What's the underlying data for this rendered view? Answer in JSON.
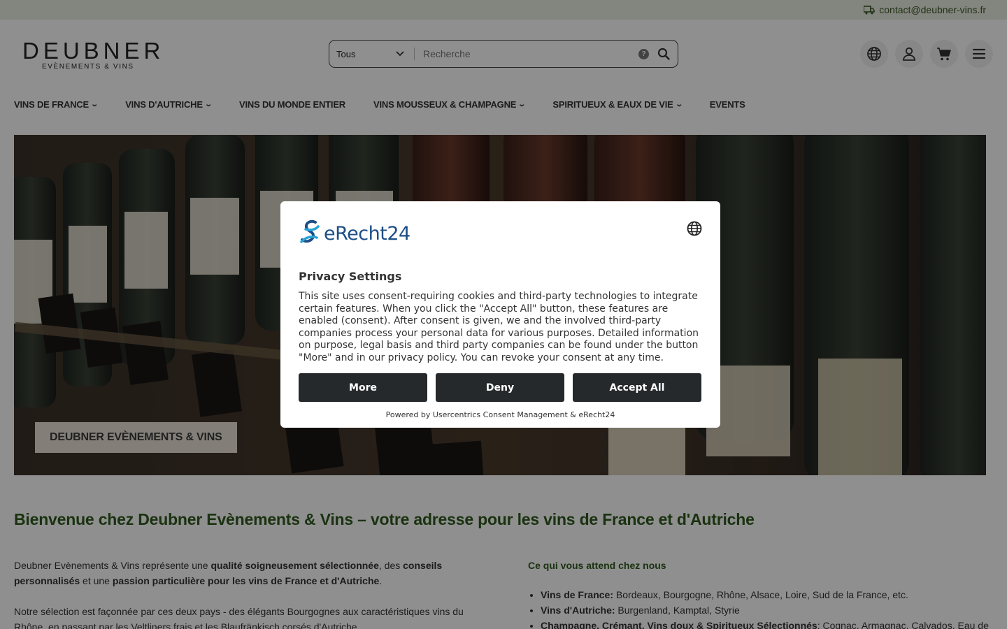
{
  "topbar": {
    "email": "contact@deubner-vins.fr"
  },
  "logo": {
    "word": "DEUBNER",
    "tagline": "EVÈNEMENTS & VINS"
  },
  "search": {
    "category": "Tous",
    "placeholder": "Recherche",
    "help": "?"
  },
  "header_icons": [
    "globe-icon",
    "user-icon",
    "cart-icon",
    "menu-icon"
  ],
  "nav": {
    "items": [
      {
        "label": "VINS DE FRANCE",
        "dropdown": true
      },
      {
        "label": "VINS D'AUTRICHE",
        "dropdown": true
      },
      {
        "label": "VINS DU MONDE ENTIER",
        "dropdown": false
      },
      {
        "label": "VINS MOUSSEUX & CHAMPAGNE",
        "dropdown": true
      },
      {
        "label": "SPIRITUEUX & EAUX DE VIE",
        "dropdown": true
      },
      {
        "label": "EVENTS",
        "dropdown": false
      }
    ]
  },
  "hero": {
    "tag": "DEUBNER EVÈNEMENTS & VINS"
  },
  "welcome": "Bienvenue chez Deubner Evènements & Vins – votre adresse pour les vins de France et d'Autriche",
  "intro": {
    "p1_a": "Deubner Evènements & Vins représente une ",
    "p1_b": "qualité soigneusement sélectionnée",
    "p1_c": ", des ",
    "p1_d": "conseils personnalisés",
    "p1_e": " et une ",
    "p1_f": "passion particulière pour les vins de France et d'Autriche",
    "p1_g": ".",
    "p2": "Notre sélection est façonnée par ces deux pays - des élégants Bourgognes aux caractéristiques vins du Rhône, en passant par les Veltliners frais et les Blaufränkisch corsés d'Autriche."
  },
  "offer": {
    "heading": "Ce qui vous attend chez nous",
    "items": [
      {
        "label": "Vins de France:",
        "text": " Bordeaux, Bourgogne, Rhône, Alsace, Loire, Sud de la France, etc."
      },
      {
        "label": "Vins d'Autriche:",
        "text": " Burgenland, Kamptal, Styrie"
      },
      {
        "label": "Champagne, Crémant, Vins doux & Spiritueux Sélectionnés",
        "text": ": Cognac, Armagnac, Calvados, Eau de"
      }
    ]
  },
  "consent": {
    "brand": "eRecht24",
    "title": "Privacy Settings",
    "text": "This site uses consent-requiring cookies and third-party technologies to integrate certain features. When you click the \"Accept All\" button, these features are enabled (consent). After consent is given, we and the involved third-party companies process your personal data for various purposes. Detailed information on purpose, legal basis and third party companies can be found under the button \"More\" and in our privacy policy. You can revoke your consent at any time.",
    "buttons": {
      "more": "More",
      "deny": "Deny",
      "accept": "Accept All"
    },
    "powered": "Powered by Usercentrics Consent Management & eRecht24"
  },
  "colors": {
    "accent_green": "#2f5a1e",
    "button_dark": "#26292c",
    "brand_blue": "#1d4e86",
    "topbar_bg": "#e9eee2"
  }
}
